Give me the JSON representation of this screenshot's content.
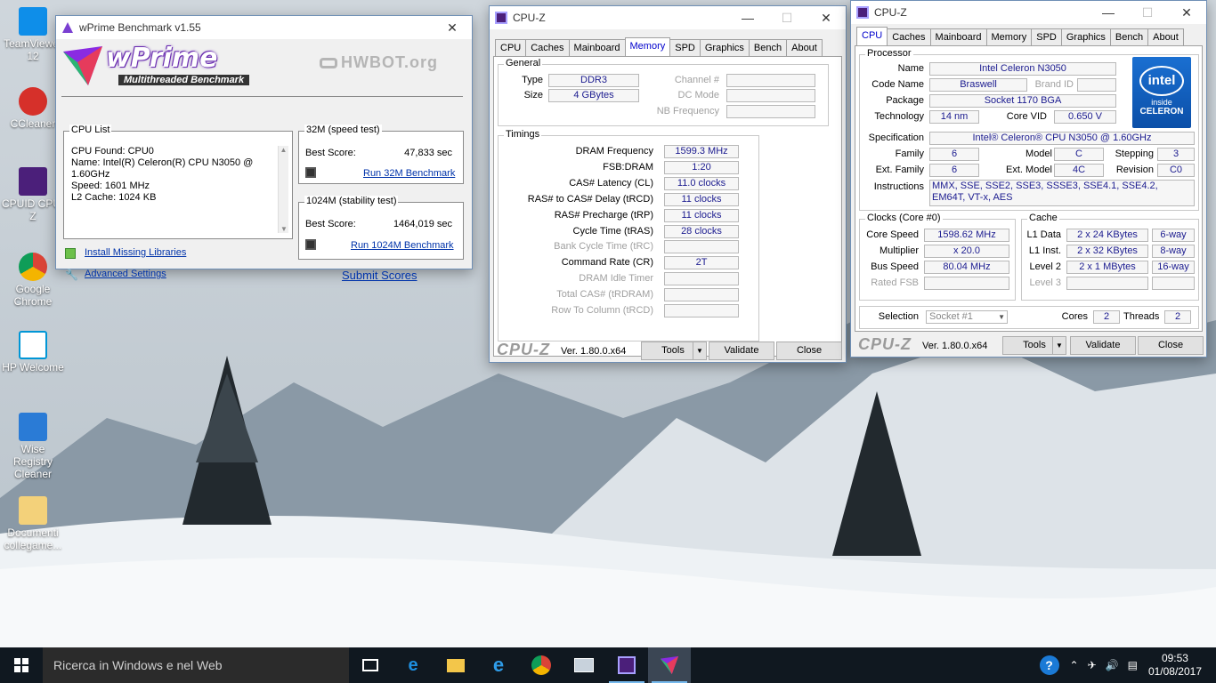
{
  "desktop_icons": [
    {
      "label": "TeamViewer 12"
    },
    {
      "label": "CCleaner"
    },
    {
      "label": "CPUID CPU-Z"
    },
    {
      "label": "Google Chrome"
    },
    {
      "label": "HP Welcome"
    },
    {
      "label": "Wise Registry Cleaner"
    },
    {
      "label": "Documenti collegame..."
    }
  ],
  "wprime": {
    "title": "wPrime Benchmark v1.55",
    "logo": "wPrime",
    "subtitle": "Multithreaded Benchmark",
    "hwbot": "HWBOT.org",
    "cpu_list_label": "CPU List",
    "cpu_list_lines": [
      "CPU Found: CPU0",
      "Name:    Intel(R) Celeron(R) CPU  N3050  @",
      "1.60GHz",
      "Speed:    1601 MHz",
      "L2 Cache: 1024 KB"
    ],
    "speed_test_label": "32M (speed test)",
    "stability_test_label": "1024M (stability test)",
    "best_score_label": "Best Score:",
    "score_32m": "47,833 sec",
    "score_1024m": "1464,019 sec",
    "run_32m": "Run 32M Benchmark",
    "run_1024m": "Run 1024M Benchmark",
    "install_libs": "Install Missing Libraries",
    "advanced": "Advanced Settings",
    "submit": "Submit Scores"
  },
  "cpuz_mem": {
    "title": "CPU-Z",
    "tabs": [
      "CPU",
      "Caches",
      "Mainboard",
      "Memory",
      "SPD",
      "Graphics",
      "Bench",
      "About"
    ],
    "general_label": "General",
    "type_label": "Type",
    "type": "DDR3",
    "size_label": "Size",
    "size": "4 GBytes",
    "channel_label": "Channel #",
    "dcmode_label": "DC Mode",
    "nbfreq_label": "NB Frequency",
    "timings_label": "Timings",
    "timings": [
      {
        "label": "DRAM Frequency",
        "value": "1599.3 MHz"
      },
      {
        "label": "FSB:DRAM",
        "value": "1:20"
      },
      {
        "label": "CAS# Latency (CL)",
        "value": "11.0 clocks"
      },
      {
        "label": "RAS# to CAS# Delay (tRCD)",
        "value": "11 clocks"
      },
      {
        "label": "RAS# Precharge (tRP)",
        "value": "11 clocks"
      },
      {
        "label": "Cycle Time (tRAS)",
        "value": "28 clocks"
      },
      {
        "label": "Bank Cycle Time (tRC)",
        "value": ""
      },
      {
        "label": "Command Rate (CR)",
        "value": "2T"
      },
      {
        "label": "DRAM Idle Timer",
        "value": ""
      },
      {
        "label": "Total CAS# (tRDRAM)",
        "value": ""
      },
      {
        "label": "Row To Column (tRCD)",
        "value": ""
      }
    ],
    "logo": "CPU-Z",
    "version": "Ver. 1.80.0.x64",
    "tools": "Tools",
    "validate": "Validate",
    "close": "Close"
  },
  "cpuz_cpu": {
    "title": "CPU-Z",
    "tabs": [
      "CPU",
      "Caches",
      "Mainboard",
      "Memory",
      "SPD",
      "Graphics",
      "Bench",
      "About"
    ],
    "processor_label": "Processor",
    "name_label": "Name",
    "name": "Intel Celeron N3050",
    "codename_label": "Code Name",
    "codename": "Braswell",
    "brandid_label": "Brand ID",
    "package_label": "Package",
    "package": "Socket 1170 BGA",
    "technology_label": "Technology",
    "technology": "14 nm",
    "corevid_label": "Core VID",
    "corevid": "0.650 V",
    "spec_label": "Specification",
    "spec": "Intel® Celeron® CPU  N3050  @ 1.60GHz",
    "family_label": "Family",
    "family": "6",
    "model_label": "Model",
    "model": "C",
    "stepping_label": "Stepping",
    "stepping": "3",
    "extfamily_label": "Ext. Family",
    "extfamily": "6",
    "extmodel_label": "Ext. Model",
    "extmodel": "4C",
    "revision_label": "Revision",
    "revision": "C0",
    "instructions_label": "Instructions",
    "instructions": "MMX, SSE, SSE2, SSE3, SSSE3, SSE4.1, SSE4.2, EM64T, VT-x, AES",
    "clocks_label": "Clocks (Core #0)",
    "corespeed_label": "Core Speed",
    "corespeed": "1598.62 MHz",
    "multiplier_label": "Multiplier",
    "multiplier": "x 20.0",
    "busspeed_label": "Bus Speed",
    "busspeed": "80.04 MHz",
    "ratedfsb_label": "Rated FSB",
    "cache_label": "Cache",
    "l1data_label": "L1 Data",
    "l1data": "2 x 24 KBytes",
    "l1data_way": "6-way",
    "l1inst_label": "L1 Inst.",
    "l1inst": "2 x 32 KBytes",
    "l1inst_way": "8-way",
    "level2_label": "Level 2",
    "level2": "2 x 1 MBytes",
    "level2_way": "16-way",
    "level3_label": "Level 3",
    "selection_label": "Selection",
    "selection": "Socket #1",
    "cores_label": "Cores",
    "cores": "2",
    "threads_label": "Threads",
    "threads": "2",
    "intel_logo": "intel",
    "intel_inside": "inside",
    "intel_brand": "CELERON",
    "logo": "CPU-Z",
    "version": "Ver. 1.80.0.x64",
    "tools": "Tools",
    "validate": "Validate",
    "close": "Close"
  },
  "taskbar": {
    "search_placeholder": "Ricerca in Windows e nel Web",
    "time": "09:53",
    "date": "01/08/2017"
  }
}
